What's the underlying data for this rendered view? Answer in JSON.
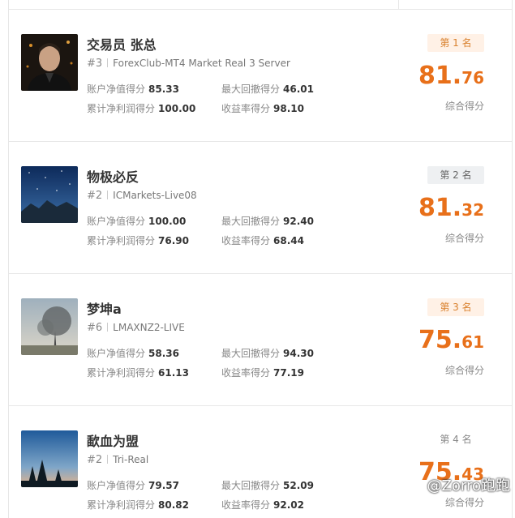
{
  "labels": {
    "equity": "账户净值得分",
    "drawdown": "最大回撤得分",
    "profit": "累计净利润得分",
    "return": "收益率得分",
    "composite": "综合得分"
  },
  "traders": [
    {
      "name": "交易员 张总",
      "rank_num": "#3",
      "server": "ForexClub-MT4 Market Real 3 Server",
      "equity": "85.33",
      "drawdown": "46.01",
      "profit": "100.00",
      "return": "98.10",
      "badge": "第 1 名",
      "score_int": "81.",
      "score_dec": "76"
    },
    {
      "name": "物极必反",
      "rank_num": "#2",
      "server": "ICMarkets-Live08",
      "equity": "100.00",
      "drawdown": "92.40",
      "profit": "76.90",
      "return": "68.44",
      "badge": "第 2 名",
      "score_int": "81.",
      "score_dec": "32"
    },
    {
      "name": "梦坤a",
      "rank_num": "#6",
      "server": "LMAXNZ2-LIVE",
      "equity": "58.36",
      "drawdown": "94.30",
      "profit": "61.13",
      "return": "77.19",
      "badge": "第 3 名",
      "score_int": "75.",
      "score_dec": "61"
    },
    {
      "name": "歃血为盟",
      "rank_num": "#2",
      "server": "Tri-Real",
      "equity": "79.57",
      "drawdown": "52.09",
      "profit": "80.82",
      "return": "92.02",
      "badge": "第 4 名",
      "score_int": "75.",
      "score_dec": "43"
    }
  ],
  "watermark": "@Zorro跑跑",
  "colors": {
    "accent": "#e8701a",
    "badge_gold_bg": "#fff1e6",
    "badge_grey_bg": "#eef0f2"
  }
}
